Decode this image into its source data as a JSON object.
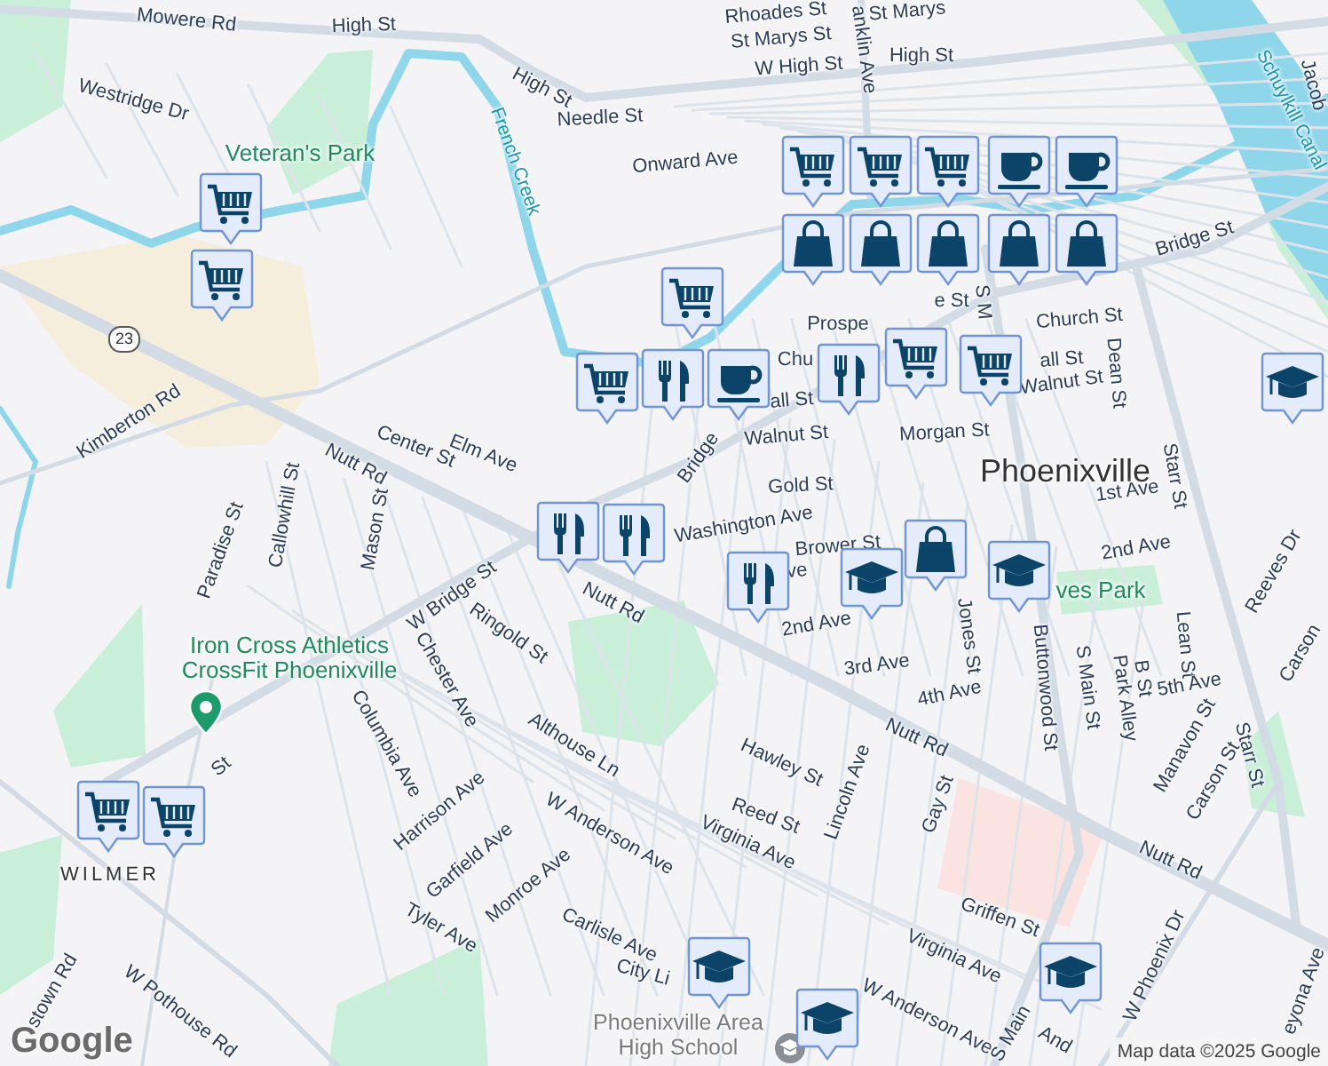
{
  "map": {
    "labels": [
      {
        "text": "Mowere Rd",
        "kind": "street"
      },
      {
        "text": "High St",
        "kind": "street"
      },
      {
        "text": "Westridge Dr",
        "kind": "street"
      },
      {
        "text": "High St",
        "kind": "street"
      },
      {
        "text": "Needle St",
        "kind": "street"
      },
      {
        "text": "Veteran's Park",
        "kind": "park"
      },
      {
        "text": "French Creek",
        "kind": "water"
      },
      {
        "text": "Onward Ave",
        "kind": "street"
      },
      {
        "text": "Rhoades St",
        "kind": "street"
      },
      {
        "text": "St Marys St",
        "kind": "street"
      },
      {
        "text": "St Marys",
        "kind": "street"
      },
      {
        "text": "W High St",
        "kind": "street"
      },
      {
        "text": "High St",
        "kind": "street"
      },
      {
        "text": "anklin Ave",
        "kind": "street"
      },
      {
        "text": "Schuylkill Canal",
        "kind": "water"
      },
      {
        "text": "Jacob",
        "kind": "street"
      },
      {
        "text": "Bridge St",
        "kind": "street"
      },
      {
        "text": "e St",
        "kind": "street"
      },
      {
        "text": "S M",
        "kind": "street"
      },
      {
        "text": "Church St",
        "kind": "street"
      },
      {
        "text": "all St",
        "kind": "street"
      },
      {
        "text": "Walnut St",
        "kind": "street"
      },
      {
        "text": "Dean St",
        "kind": "street"
      },
      {
        "text": "Prospe",
        "kind": "street"
      },
      {
        "text": "Chu",
        "kind": "street"
      },
      {
        "text": "all St",
        "kind": "street"
      },
      {
        "text": "Walnut St",
        "kind": "street"
      },
      {
        "text": "Bridge",
        "kind": "street"
      },
      {
        "text": "Morgan St",
        "kind": "street"
      },
      {
        "text": "Phoenixville",
        "kind": "town"
      },
      {
        "text": "Starr St",
        "kind": "street"
      },
      {
        "text": "1st Ave",
        "kind": "street"
      },
      {
        "text": "Gold St",
        "kind": "street"
      },
      {
        "text": "Kimberton Rd",
        "kind": "street"
      },
      {
        "text": "Center St",
        "kind": "street"
      },
      {
        "text": "Elm Ave",
        "kind": "street"
      },
      {
        "text": "Nutt Rd",
        "kind": "street"
      },
      {
        "text": "Callowhill St",
        "kind": "street"
      },
      {
        "text": "Mason St",
        "kind": "street"
      },
      {
        "text": "Paradise St",
        "kind": "street"
      },
      {
        "text": "W Bridge St",
        "kind": "street"
      },
      {
        "text": "Nutt Rd",
        "kind": "street"
      },
      {
        "text": "Ringold St",
        "kind": "street"
      },
      {
        "text": "Washington Ave",
        "kind": "street"
      },
      {
        "text": "Brower St",
        "kind": "street"
      },
      {
        "text": "ve",
        "kind": "street"
      },
      {
        "text": "2nd Ave",
        "kind": "street"
      },
      {
        "text": "2nd Ave",
        "kind": "street"
      },
      {
        "text": "ves Park",
        "kind": "park"
      },
      {
        "text": "Reeves Dr",
        "kind": "street"
      },
      {
        "text": "Carson",
        "kind": "street"
      },
      {
        "text": "3rd Ave",
        "kind": "street"
      },
      {
        "text": "4th Ave",
        "kind": "street"
      },
      {
        "text": "Jones St",
        "kind": "street"
      },
      {
        "text": "Buttonwood St",
        "kind": "street"
      },
      {
        "text": "S Main St",
        "kind": "street"
      },
      {
        "text": "Park Alley",
        "kind": "street"
      },
      {
        "text": "B St",
        "kind": "street"
      },
      {
        "text": "Lean St",
        "kind": "street"
      },
      {
        "text": "5th Ave",
        "kind": "street"
      },
      {
        "text": "Manavon St",
        "kind": "street"
      },
      {
        "text": "Carson St",
        "kind": "street"
      },
      {
        "text": "Starr St",
        "kind": "street"
      },
      {
        "text": "Nutt Rd",
        "kind": "street"
      },
      {
        "text": "Nutt Rd",
        "kind": "street"
      },
      {
        "text": "Hawley St",
        "kind": "street"
      },
      {
        "text": "Lincoln Ave",
        "kind": "street"
      },
      {
        "text": "Gay St",
        "kind": "street"
      },
      {
        "text": "Reed St",
        "kind": "street"
      },
      {
        "text": "Virginia Ave",
        "kind": "street"
      },
      {
        "text": "Griffen St",
        "kind": "street"
      },
      {
        "text": "Virginia Ave",
        "kind": "street"
      },
      {
        "text": "W Anderson Ave",
        "kind": "street"
      },
      {
        "text": "S Main",
        "kind": "street"
      },
      {
        "text": "W Phoenix Dr",
        "kind": "street"
      },
      {
        "text": "eyona Ave",
        "kind": "street"
      },
      {
        "text": "And",
        "kind": "street"
      },
      {
        "text": "Iron Cross Athletics CrossFit Phoenixville",
        "kind": "poi"
      },
      {
        "text": "Chester Ave",
        "kind": "street"
      },
      {
        "text": "Columbia Ave",
        "kind": "street"
      },
      {
        "text": "Althouse Ln",
        "kind": "street"
      },
      {
        "text": "Harrison Ave",
        "kind": "street"
      },
      {
        "text": "Garfield Ave",
        "kind": "street"
      },
      {
        "text": "W Anderson Ave",
        "kind": "street"
      },
      {
        "text": "Monroe Ave",
        "kind": "street"
      },
      {
        "text": "Tyler Ave",
        "kind": "street"
      },
      {
        "text": "Carlisle Ave",
        "kind": "street"
      },
      {
        "text": "City Li",
        "kind": "street"
      },
      {
        "text": "St",
        "kind": "street"
      },
      {
        "text": "WILMER",
        "kind": "district"
      },
      {
        "text": "stown Rd",
        "kind": "street"
      },
      {
        "text": "W Pothouse Rd",
        "kind": "street"
      },
      {
        "text": "Phoenixville Area High School",
        "kind": "school"
      },
      {
        "text": "23",
        "kind": "shield"
      }
    ],
    "markers": [
      {
        "kind": "cart"
      },
      {
        "kind": "cart"
      },
      {
        "kind": "cart"
      },
      {
        "kind": "cart"
      },
      {
        "kind": "cart"
      },
      {
        "kind": "cart"
      },
      {
        "kind": "bag"
      },
      {
        "kind": "bag"
      },
      {
        "kind": "bag"
      },
      {
        "kind": "bag"
      },
      {
        "kind": "bag"
      },
      {
        "kind": "cup"
      },
      {
        "kind": "cup"
      },
      {
        "kind": "cart"
      },
      {
        "kind": "fork"
      },
      {
        "kind": "cup"
      },
      {
        "kind": "fork"
      },
      {
        "kind": "cart"
      },
      {
        "kind": "cart"
      },
      {
        "kind": "cap"
      },
      {
        "kind": "fork"
      },
      {
        "kind": "fork"
      },
      {
        "kind": "fork"
      },
      {
        "kind": "cap"
      },
      {
        "kind": "bag"
      },
      {
        "kind": "cap"
      },
      {
        "kind": "cap"
      },
      {
        "kind": "cap"
      },
      {
        "kind": "cap"
      },
      {
        "kind": "cart"
      },
      {
        "kind": "cart"
      },
      {
        "kind": "pin"
      }
    ]
  },
  "attribution": {
    "logo": "Google",
    "text": "Map data ©2025 Google"
  }
}
